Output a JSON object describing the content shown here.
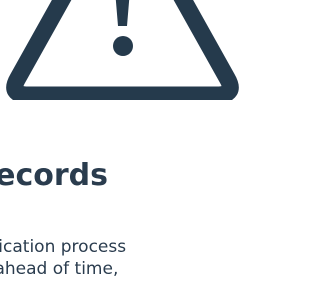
{
  "icon": {
    "name": "warning-icon",
    "color": "#253a4c"
  },
  "section": {
    "title": "Records",
    "body_lines": [
      "pplication process",
      "re ahead of time,"
    ]
  },
  "colors": {
    "text": "#2a3c4e",
    "background": "#ffffff"
  }
}
